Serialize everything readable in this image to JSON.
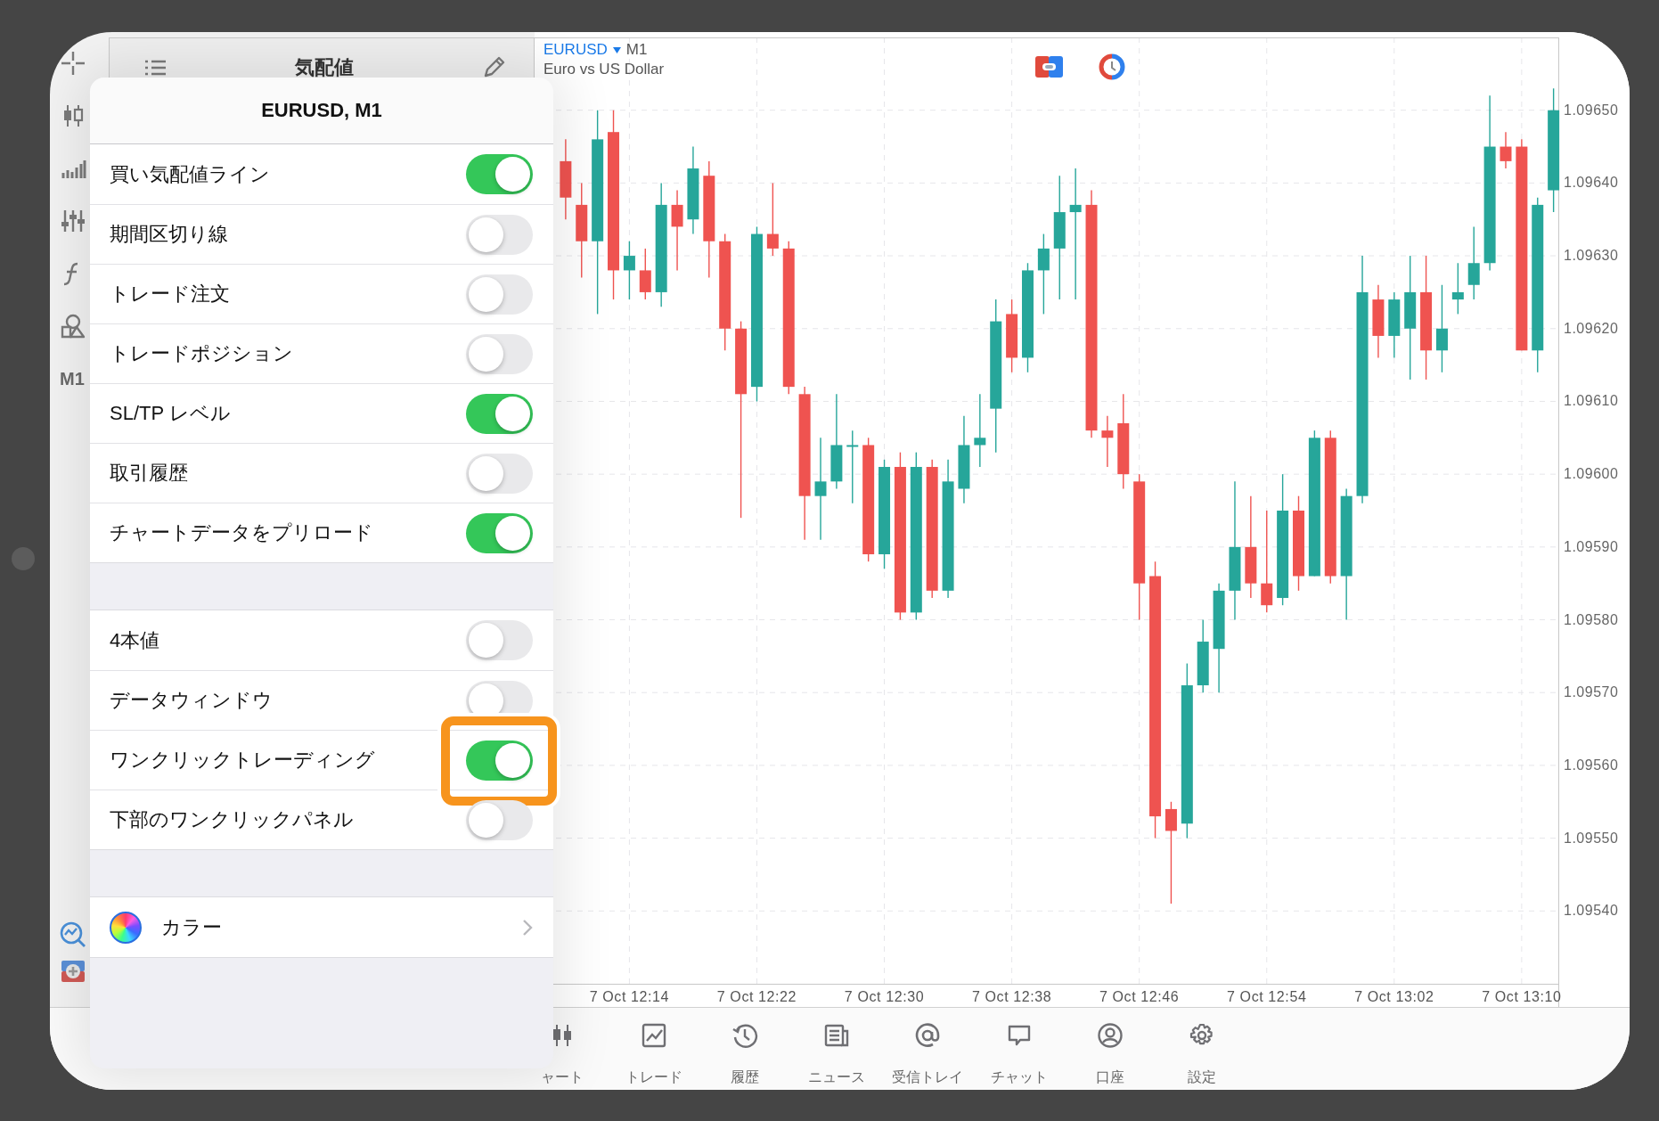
{
  "sidebar": {
    "timeframe": "M1"
  },
  "quotes_panel": {
    "title": "気配値"
  },
  "chart": {
    "symbol": "EURUSD",
    "timeframe": "M1",
    "description": "Euro vs US Dollar",
    "chart_data": {
      "type": "candlestick",
      "grid": true,
      "categories": [
        null,
        null,
        null,
        null,
        "7 Oct 12:14",
        null,
        null,
        null,
        null,
        null,
        null,
        null,
        "7 Oct 12:22",
        null,
        null,
        null,
        null,
        null,
        null,
        null,
        "7 Oct 12:30",
        null,
        null,
        null,
        null,
        null,
        null,
        null,
        "7 Oct 12:38",
        null,
        null,
        null,
        null,
        null,
        null,
        null,
        "7 Oct 12:46",
        null,
        null,
        null,
        null,
        null,
        null,
        null,
        "7 Oct 12:54",
        null,
        null,
        null,
        null,
        null,
        null,
        null,
        "7 Oct 13:02",
        null,
        null,
        null,
        null,
        null,
        null,
        null,
        "7 Oct 13:10",
        null,
        null
      ],
      "ohlc": [
        [
          1.09643,
          1.09646,
          1.09635,
          1.09638
        ],
        [
          1.09637,
          1.0964,
          1.09627,
          1.09632
        ],
        [
          1.09632,
          1.0965,
          1.09622,
          1.09646
        ],
        [
          1.09647,
          1.0965,
          1.09624,
          1.09628
        ],
        [
          1.09628,
          1.09632,
          1.09624,
          1.0963
        ],
        [
          1.09628,
          1.09631,
          1.09624,
          1.09625
        ],
        [
          1.09625,
          1.0964,
          1.09623,
          1.09637
        ],
        [
          1.09637,
          1.09639,
          1.09628,
          1.09634
        ],
        [
          1.09635,
          1.09645,
          1.09633,
          1.09642
        ],
        [
          1.09641,
          1.09643,
          1.09627,
          1.09632
        ],
        [
          1.09632,
          1.09633,
          1.09617,
          1.0962
        ],
        [
          1.0962,
          1.09621,
          1.09594,
          1.09611
        ],
        [
          1.09612,
          1.09634,
          1.0961,
          1.09633
        ],
        [
          1.09633,
          1.0964,
          1.0963,
          1.09631
        ],
        [
          1.09631,
          1.09632,
          1.09611,
          1.09612
        ],
        [
          1.09611,
          1.09612,
          1.09591,
          1.09597
        ],
        [
          1.09597,
          1.09605,
          1.09591,
          1.09599
        ],
        [
          1.09599,
          1.09611,
          1.09598,
          1.09604
        ],
        [
          1.09604,
          1.09606,
          1.09596,
          1.09604
        ],
        [
          1.09604,
          1.09605,
          1.09588,
          1.09589
        ],
        [
          1.09589,
          1.09602,
          1.09587,
          1.09601
        ],
        [
          1.09601,
          1.09603,
          1.0958,
          1.09581
        ],
        [
          1.09581,
          1.09603,
          1.0958,
          1.09601
        ],
        [
          1.09601,
          1.09602,
          1.09583,
          1.09584
        ],
        [
          1.09584,
          1.09602,
          1.09583,
          1.09599
        ],
        [
          1.09598,
          1.09608,
          1.09596,
          1.09604
        ],
        [
          1.09604,
          1.09611,
          1.09601,
          1.09605
        ],
        [
          1.09609,
          1.09624,
          1.09603,
          1.09621
        ],
        [
          1.09622,
          1.09624,
          1.09614,
          1.09616
        ],
        [
          1.09616,
          1.09629,
          1.09614,
          1.09628
        ],
        [
          1.09628,
          1.09633,
          1.09622,
          1.09631
        ],
        [
          1.09631,
          1.09641,
          1.09624,
          1.09636
        ],
        [
          1.09636,
          1.09642,
          1.09624,
          1.09637
        ],
        [
          1.09637,
          1.09639,
          1.09605,
          1.09606
        ],
        [
          1.09606,
          1.09608,
          1.09601,
          1.09605
        ],
        [
          1.09607,
          1.09611,
          1.09598,
          1.096
        ],
        [
          1.09599,
          1.096,
          1.0958,
          1.09585
        ],
        [
          1.09586,
          1.09588,
          1.0955,
          1.09553
        ],
        [
          1.09554,
          1.09555,
          1.09541,
          1.09551
        ],
        [
          1.09552,
          1.09574,
          1.0955,
          1.09571
        ],
        [
          1.09571,
          1.0958,
          1.0957,
          1.09577
        ],
        [
          1.09576,
          1.09585,
          1.0957,
          1.09584
        ],
        [
          1.09584,
          1.09599,
          1.0958,
          1.0959
        ],
        [
          1.0959,
          1.09597,
          1.09583,
          1.09585
        ],
        [
          1.09585,
          1.09595,
          1.09581,
          1.09582
        ],
        [
          1.09583,
          1.096,
          1.09582,
          1.09595
        ],
        [
          1.09595,
          1.09597,
          1.09584,
          1.09586
        ],
        [
          1.09586,
          1.09606,
          1.09586,
          1.09605
        ],
        [
          1.09605,
          1.09606,
          1.09585,
          1.09586
        ],
        [
          1.09586,
          1.09598,
          1.0958,
          1.09597
        ],
        [
          1.09597,
          1.0963,
          1.09596,
          1.09625
        ],
        [
          1.09624,
          1.09626,
          1.09616,
          1.09619
        ],
        [
          1.09619,
          1.09625,
          1.09616,
          1.09624
        ],
        [
          1.0962,
          1.0963,
          1.09613,
          1.09625
        ],
        [
          1.09625,
          1.0963,
          1.09613,
          1.09617
        ],
        [
          1.09617,
          1.09626,
          1.09614,
          1.0962
        ],
        [
          1.09624,
          1.09629,
          1.09622,
          1.09625
        ],
        [
          1.09626,
          1.09634,
          1.09624,
          1.09629
        ],
        [
          1.09629,
          1.09652,
          1.09628,
          1.09645
        ],
        [
          1.09645,
          1.09647,
          1.09642,
          1.09643
        ],
        [
          1.09645,
          1.09646,
          1.09617,
          1.09617
        ],
        [
          1.09617,
          1.09638,
          1.09614,
          1.09637
        ],
        [
          1.09639,
          1.09653,
          1.09636,
          1.0965
        ]
      ],
      "ylim": [
        1.0953,
        1.0966
      ],
      "yticks": [
        {
          "value": 1.0965,
          "label": "1.09650"
        },
        {
          "value": 1.0964,
          "label": "1.09640"
        },
        {
          "value": 1.0963,
          "label": "1.09630"
        },
        {
          "value": 1.0962,
          "label": "1.09620"
        },
        {
          "value": 1.0961,
          "label": "1.09610"
        },
        {
          "value": 1.096,
          "label": "1.09600"
        },
        {
          "value": 1.0959,
          "label": "1.09590"
        },
        {
          "value": 1.0958,
          "label": "1.09580"
        },
        {
          "value": 1.0957,
          "label": "1.09570"
        },
        {
          "value": 1.0956,
          "label": "1.09560"
        },
        {
          "value": 1.0955,
          "label": "1.09550"
        },
        {
          "value": 1.0954,
          "label": "1.09540"
        }
      ]
    }
  },
  "tab_bar": [
    {
      "label": "ャート",
      "selected": false
    },
    {
      "label": "トレード",
      "selected": false
    },
    {
      "label": "履歴",
      "selected": false
    },
    {
      "label": "ニュース",
      "selected": false
    },
    {
      "label": "受信トレイ",
      "selected": false
    },
    {
      "label": "チャット",
      "selected": false
    },
    {
      "label": "口座",
      "selected": false
    },
    {
      "label": "設定",
      "selected": false
    }
  ],
  "settings_popover": {
    "title": "EURUSD, M1",
    "groups": [
      {
        "items": [
          {
            "kind": "toggle",
            "label": "買い気配値ライン",
            "on": true,
            "highlighted": false
          },
          {
            "kind": "toggle",
            "label": "期間区切り線",
            "on": false,
            "highlighted": false
          },
          {
            "kind": "toggle",
            "label": "トレード注文",
            "on": false,
            "highlighted": false
          },
          {
            "kind": "toggle",
            "label": "トレードポジション",
            "on": false,
            "highlighted": false
          },
          {
            "kind": "toggle",
            "label": "SL/TP レベル",
            "on": true,
            "highlighted": false
          },
          {
            "kind": "toggle",
            "label": "取引履歴",
            "on": false,
            "highlighted": false
          },
          {
            "kind": "toggle",
            "label": "チャートデータをプリロード",
            "on": true,
            "highlighted": false
          }
        ]
      },
      {
        "items": [
          {
            "kind": "toggle",
            "label": "4本値",
            "on": false,
            "highlighted": false
          },
          {
            "kind": "toggle",
            "label": "データウィンドウ",
            "on": false,
            "highlighted": false
          },
          {
            "kind": "toggle",
            "label": "ワンクリックトレーディング",
            "on": true,
            "highlighted": true
          },
          {
            "kind": "toggle",
            "label": "下部のワンクリックパネル",
            "on": false,
            "highlighted": false
          }
        ]
      },
      {
        "items": [
          {
            "kind": "link",
            "label": "カラー"
          }
        ]
      }
    ]
  }
}
